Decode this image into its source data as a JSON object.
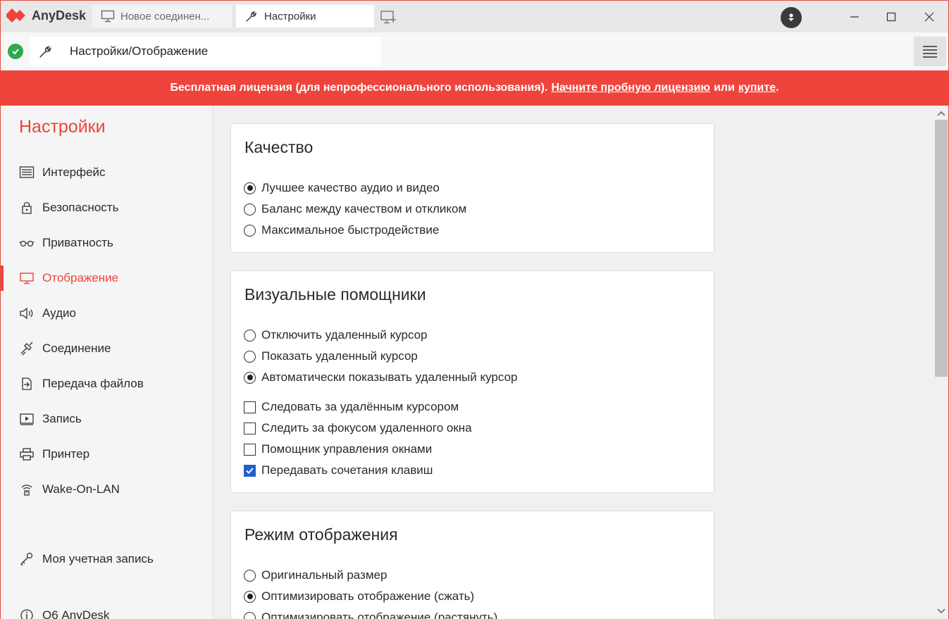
{
  "app": {
    "name": "AnyDesk",
    "accent": "#ef443b"
  },
  "tabs": [
    {
      "label": "Новое соединен...",
      "icon": "monitor-icon",
      "active": false
    },
    {
      "label": "Настройки",
      "icon": "wrench-icon",
      "active": true
    }
  ],
  "address": {
    "status": "connected-ok",
    "path": "Настройки/Отображение"
  },
  "banner": {
    "text": "Бесплатная лицензия (для непрофессионального использования).",
    "link_trial": "Начните пробную лицензию",
    "middle": "или",
    "link_buy": "купите",
    "end": "."
  },
  "sidebar": {
    "title": "Настройки",
    "items": [
      {
        "label": "Интерфейс",
        "icon": "interface-icon"
      },
      {
        "label": "Безопасность",
        "icon": "lock-icon"
      },
      {
        "label": "Приватность",
        "icon": "glasses-icon"
      },
      {
        "label": "Отображение",
        "icon": "display-icon",
        "active": true
      },
      {
        "label": "Аудио",
        "icon": "speaker-icon"
      },
      {
        "label": "Соединение",
        "icon": "connection-icon"
      },
      {
        "label": "Передача файлов",
        "icon": "file-transfer-icon"
      },
      {
        "label": "Запись",
        "icon": "recording-icon"
      },
      {
        "label": "Принтер",
        "icon": "printer-icon"
      },
      {
        "label": "Wake-On-LAN",
        "icon": "wake-on-lan-icon"
      }
    ],
    "account": "Моя учетная запись",
    "about": "О6 AnyDesk"
  },
  "main": {
    "quality": {
      "title": "Качество",
      "options": [
        {
          "label": "Лучшее качество аудио и видео",
          "selected": true
        },
        {
          "label": "Баланс между качеством и откликом",
          "selected": false
        },
        {
          "label": "Максимальное быстродействие",
          "selected": false
        }
      ]
    },
    "visual": {
      "title": "Визуальные помощники",
      "radios": [
        {
          "label": "Отключить удаленный курсор",
          "selected": false
        },
        {
          "label": "Показать удаленный курсор",
          "selected": false
        },
        {
          "label": "Автоматически показывать удаленный курсор",
          "selected": true
        }
      ],
      "checks": [
        {
          "label": "Следовать за удалённым курсором",
          "checked": false
        },
        {
          "label": "Следить за фокусом удаленного окна",
          "checked": false
        },
        {
          "label": "Помощник управления окнами",
          "checked": false
        },
        {
          "label": "Передавать сочетания клавиш",
          "checked": true
        }
      ]
    },
    "display_mode": {
      "title": "Режим отображения",
      "options": [
        {
          "label": "Оригинальный размер",
          "selected": false
        },
        {
          "label": "Оптимизировать отображение (сжать)",
          "selected": true
        },
        {
          "label": "Оптимизировать отображение (растянуть)",
          "selected": false
        }
      ]
    }
  }
}
